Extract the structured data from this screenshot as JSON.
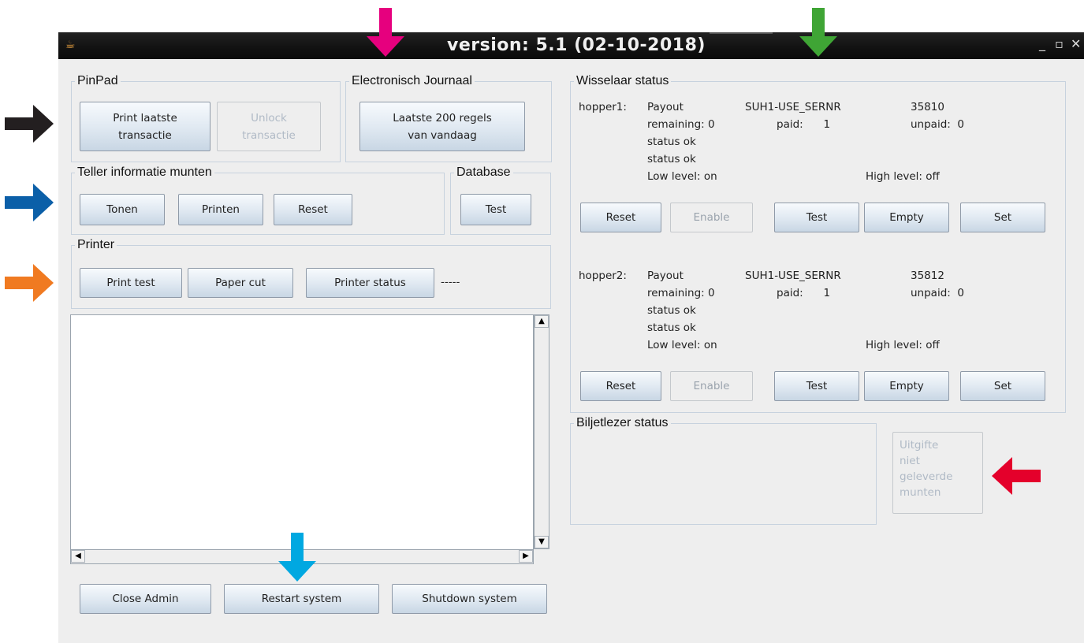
{
  "window": {
    "title": "version: 5.1 (02-10-2018)",
    "java_icon": "java-cup-icon",
    "controls": {
      "minimize": "_",
      "maximize": "▫",
      "close": "✕"
    }
  },
  "pinpad": {
    "legend": "PinPad",
    "print_label": "Print laatste\ntransactie",
    "unlock_label": "Unlock\ntransactie"
  },
  "journaal": {
    "legend": "Electronisch Journaal",
    "button_label": "Laatste 200 regels\nvan vandaag"
  },
  "teller": {
    "legend": "Teller informatie munten",
    "tonen": "Tonen",
    "printen": "Printen",
    "reset": "Reset"
  },
  "database": {
    "legend": "Database",
    "test": "Test"
  },
  "printer": {
    "legend": "Printer",
    "print_test": "Print test",
    "paper_cut": "Paper cut",
    "printer_status": "Printer status",
    "status_value": "-----"
  },
  "bottom_buttons": {
    "close_admin": "Close Admin",
    "restart": "Restart system",
    "shutdown": "Shutdown system"
  },
  "wisselaar": {
    "legend": "Wisselaar status",
    "hoppers": [
      {
        "name": "hopper1:",
        "payout": "Payout",
        "remaining": "remaining: 0",
        "status1": "status ok",
        "status2": "status ok",
        "low_level": "Low level: on",
        "serial_label": "SUH1-USE_SERNR",
        "serial_value": "35810",
        "paid": "paid:      1",
        "unpaid": "unpaid:  0",
        "high_level": "High level: off",
        "buttons": {
          "reset": "Reset",
          "enable": "Enable",
          "test": "Test",
          "empty": "Empty",
          "set": "Set"
        }
      },
      {
        "name": "hopper2:",
        "payout": "Payout",
        "remaining": "remaining: 0",
        "status1": "status ok",
        "status2": "status ok",
        "low_level": "Low level: on",
        "serial_label": "SUH1-USE_SERNR",
        "serial_value": "35812",
        "paid": "paid:      1",
        "unpaid": "unpaid:  0",
        "high_level": "High level: off",
        "buttons": {
          "reset": "Reset",
          "enable": "Enable",
          "test": "Test",
          "empty": "Empty",
          "set": "Set"
        }
      }
    ]
  },
  "biljet": {
    "legend": "Biljetlezer status",
    "uitgifte_label": "Uitgifte\nniet\ngeleverde\nmunten"
  },
  "annotation_arrows": {
    "colors": {
      "black": "#231f20",
      "blue": "#0b5fa8",
      "orange": "#f07a21",
      "magenta": "#e6007e",
      "green": "#3fa535",
      "cyan": "#00a8e1",
      "red": "#e4002b"
    }
  }
}
